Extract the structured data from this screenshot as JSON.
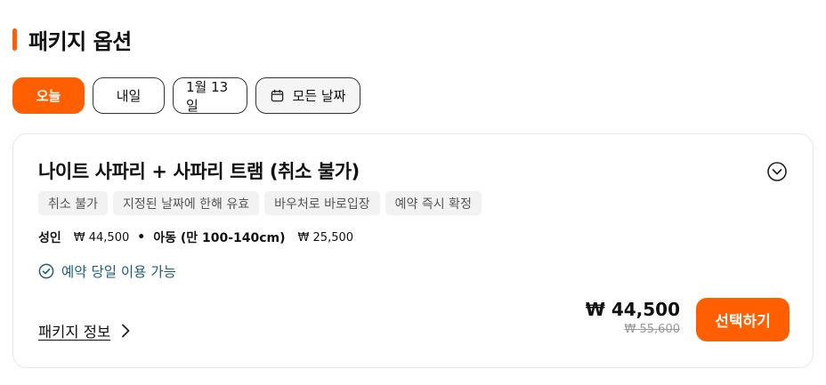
{
  "section": {
    "title": "패키지 옵션"
  },
  "dates": [
    {
      "label": "오늘",
      "active": true
    },
    {
      "label": "내일",
      "active": false
    },
    {
      "label": "1월 13일",
      "active": false
    }
  ],
  "all_dates": {
    "label": "모든 날짜",
    "icon": "calendar-icon"
  },
  "package": {
    "title": "나이트 사파리 + 사파리 트램 (취소 불가)",
    "tags": [
      "취소 불가",
      "지정된 날짜에 한해 유효",
      "바우처로 바로입장",
      "예약 즉시 확정"
    ],
    "prices": {
      "adult_label": "성인",
      "adult_price": "₩ 44,500",
      "separator": "•",
      "child_label": "아동 (만 100-140cm)",
      "child_price": "₩ 25,500"
    },
    "availability": "예약 당일 이용 가능",
    "info_link": "패키지 정보",
    "current_price": "₩ 44,500",
    "original_price": "₩ 55,600",
    "select_label": "선택하기"
  },
  "colors": {
    "accent": "#ff5f00",
    "availability": "#1e5f74"
  }
}
